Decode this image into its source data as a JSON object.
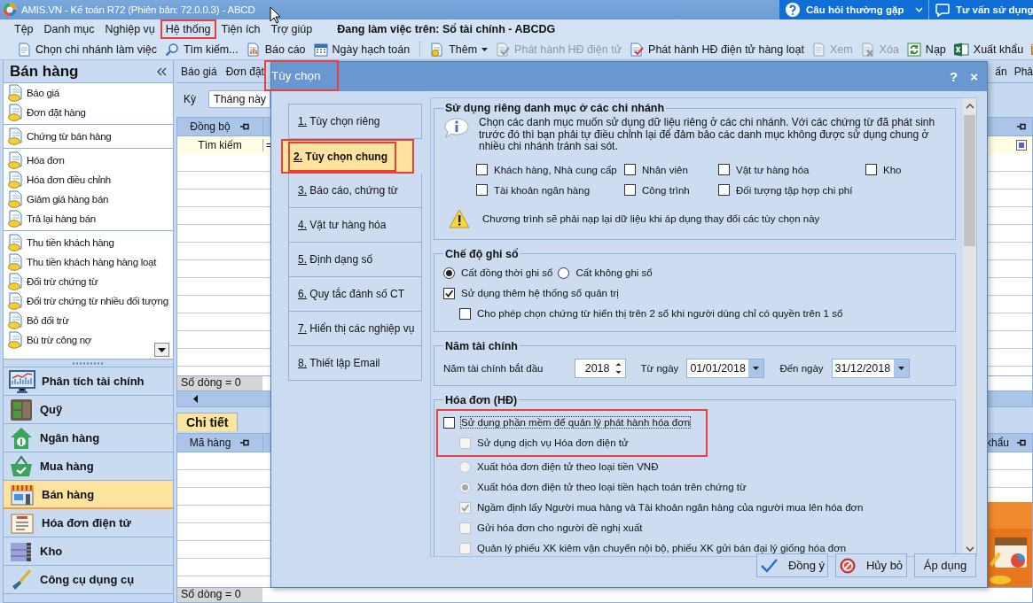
{
  "window": {
    "title": "AMIS.VN - Kế toán R72 (Phiên bản: 72.0.0.3) - ABCD"
  },
  "help_buttons": [
    {
      "label": "Câu hỏi thường gặp",
      "kind": "faq"
    },
    {
      "label": "Tư vấn sử dụng",
      "kind": "chat"
    }
  ],
  "menu": [
    {
      "label": "Tệp",
      "highlighted": false
    },
    {
      "label": "Danh mục",
      "highlighted": false
    },
    {
      "label": "Nghiệp vụ",
      "highlighted": false
    },
    {
      "label": "Hệ thống",
      "highlighted": true
    },
    {
      "label": "Tiện ích",
      "highlighted": false
    },
    {
      "label": "Trợ giúp",
      "highlighted": false
    }
  ],
  "working_on": "Đang làm việc trên: Sổ tài chính - ABCDG",
  "toolbar": [
    {
      "label": "Chọn chi nhánh làm việc",
      "kind": "branch",
      "disabled": false
    },
    {
      "label": "Tìm kiếm...",
      "kind": "search",
      "disabled": false
    },
    {
      "label": "Báo cáo",
      "kind": "report",
      "disabled": false
    },
    {
      "label": "Ngày hạch toán",
      "kind": "calendar",
      "disabled": false
    },
    {
      "kind": "separator"
    },
    {
      "label": "Thêm",
      "kind": "add",
      "disabled": false
    },
    {
      "label": "Phát hành HĐ điện tử",
      "kind": "publish",
      "disabled": true
    },
    {
      "label": "Phát hành HĐ điện tử hàng loạt",
      "kind": "publish",
      "disabled": false
    },
    {
      "label": "Xem",
      "kind": "view",
      "disabled": true
    },
    {
      "label": "Xóa",
      "kind": "delete",
      "disabled": true
    },
    {
      "label": "Nạp",
      "kind": "refresh",
      "disabled": false
    },
    {
      "label": "Xuất khẩu",
      "kind": "export",
      "disabled": false
    },
    {
      "kind": "mail",
      "disabled": false
    }
  ],
  "sidebar": {
    "title": "Bán hàng",
    "groups": [
      [
        "Báo giá",
        "Đơn đặt hàng"
      ],
      [
        "Chứng từ bán hàng"
      ],
      [
        "Hóa đơn",
        "Hóa đơn điều chỉnh",
        "Giảm giá hàng bán",
        "Trả lại hàng bán"
      ],
      [
        "Thu tiền khách hàng",
        "Thu tiền khách hàng hàng loạt",
        "Đối trừ chứng từ",
        "Đối trừ chứng từ nhiều đối tượng",
        "Bỏ đối trừ",
        "Bù trừ công nợ"
      ]
    ],
    "modules": [
      {
        "label": "Phân tích tài chính",
        "kind": "chart",
        "selected": false
      },
      {
        "label": "Quỹ",
        "kind": "safe",
        "selected": false
      },
      {
        "label": "Ngân hàng",
        "kind": "bank",
        "selected": false
      },
      {
        "label": "Mua hàng",
        "kind": "basket",
        "selected": false
      },
      {
        "label": "Bán hàng",
        "kind": "shop",
        "selected": true
      },
      {
        "label": "Hóa đơn điện tử",
        "kind": "invoice",
        "selected": false
      },
      {
        "label": "Kho",
        "kind": "warehouse",
        "selected": false
      },
      {
        "label": "Công cụ dụng cụ",
        "kind": "tool",
        "selected": false
      }
    ]
  },
  "workspace": {
    "tabs": [
      "Báo giá",
      "Đơn đặt"
    ],
    "right_tabs": [
      "ấn",
      "Phâ"
    ],
    "period": {
      "label": "Kỳ",
      "value": "Tháng này"
    },
    "master_grid": {
      "column": "Đồng bộ",
      "filter": [
        "Tìm kiếm",
        "="
      ],
      "footer": "Số dòng = 0"
    },
    "detail": {
      "tab": "Chi tiết",
      "column": "Mã hàng",
      "right_column": "khẩu",
      "footer": "Số dòng = 0"
    }
  },
  "dialog": {
    "title": "Tùy chọn",
    "title_highlighted": true,
    "help": "?",
    "close": "×",
    "nav": [
      {
        "label": "1. Tùy chọn riêng",
        "selected": false,
        "highlighted": false
      },
      {
        "label": "2. Tùy chọn chung",
        "selected": true,
        "highlighted": true
      },
      {
        "label": "3. Báo cáo, chứng từ",
        "selected": false,
        "highlighted": false
      },
      {
        "label": "4. Vật tư hàng hóa",
        "selected": false,
        "highlighted": false
      },
      {
        "label": "5. Định dạng số",
        "selected": false,
        "highlighted": false
      },
      {
        "label": "6. Quy tắc đánh số CT",
        "selected": false,
        "highlighted": false
      },
      {
        "label": "7. Hiển thị các nghiệp vụ",
        "selected": false,
        "highlighted": false
      },
      {
        "label": "8. Thiết lập Email",
        "selected": false,
        "highlighted": false
      }
    ],
    "sections": [
      {
        "kind": "branch_catalogs",
        "title": "Sử dụng riêng danh mục ở các chi nhánh",
        "info": "Chọn các danh mục muốn sử dụng dữ liệu riêng ở các chi nhánh. Với các chứng từ đã phát sinh trước đó thì bạn phải tự điều chỉnh lại để đảm bảo các danh mục không được sử dụng chung ở nhiều chi nhánh tránh sai sót.",
        "options": [
          {
            "label": "Khách hàng, Nhà cung cấp",
            "checked": false
          },
          {
            "label": "Nhân viên",
            "checked": false
          },
          {
            "label": "Vật tư hàng hóa",
            "checked": false
          },
          {
            "label": "Kho",
            "checked": false
          },
          {
            "label": "Tài khoản ngân hàng",
            "checked": false
          },
          {
            "label": "Công trình",
            "checked": false
          },
          {
            "label": "Đối tượng tập hợp chi phí",
            "checked": false
          }
        ],
        "warning": "Chương trình sẽ phải nạp lại dữ liệu khi áp dụng thay đổi các tùy chọn này"
      },
      {
        "kind": "posting_mode",
        "title": "Chế độ ghi sổ",
        "modes": [
          {
            "label": "Cất đồng thời ghi sổ",
            "selected": true
          },
          {
            "label": "Cất không ghi sổ",
            "selected": false
          }
        ],
        "options": [
          {
            "kind": "checkbox",
            "label": "Sử dụng thêm hệ thống sổ quản trị",
            "checked": true,
            "children": [
              {
                "kind": "checkbox",
                "label": "Cho phép chọn chứng từ hiển thị trên 2 sổ khi người dùng chỉ có quyền trên 1 sổ",
                "checked": false
              }
            ]
          }
        ]
      },
      {
        "kind": "fiscal_year",
        "title": "Năm tài chính",
        "start_label": "Năm tài chính bắt đầu",
        "start_year": "2018",
        "from_label": "Từ ngày",
        "from": "01/01/2018",
        "to_label": "Đến ngày",
        "to": "31/12/2018"
      },
      {
        "kind": "invoice",
        "title": "Hóa đơn (HĐ)",
        "options": [
          {
            "kind": "checkbox",
            "label": "Sử dụng phần mềm để quản lý phát hành hóa đơn",
            "checked": false,
            "disabled": false,
            "focused": true,
            "highlighted": true,
            "children": [
              {
                "kind": "checkbox",
                "label": "Sử dụng dịch vụ Hóa đơn điện tử",
                "checked": false,
                "disabled": true,
                "focused": false,
                "highlighted": true
              },
              {
                "kind": "radio",
                "label": "Xuất hóa đơn điện tử theo loại tiền VNĐ",
                "selected": false,
                "disabled": true,
                "focused": false,
                "highlighted": false
              },
              {
                "kind": "radio",
                "label": "Xuất hóa đơn điện tử theo loại tiền hạch toán trên chứng từ",
                "selected": true,
                "disabled": true,
                "focused": false,
                "highlighted": false
              },
              {
                "kind": "checkbox",
                "label": "Ngầm định lấy Người mua hàng và Tài khoản ngân hàng của người mua lên hóa đơn",
                "checked": true,
                "disabled": true,
                "focused": false,
                "highlighted": false
              },
              {
                "kind": "checkbox",
                "label": "Gửi hóa đơn cho người đề nghị xuất",
                "checked": false,
                "disabled": true,
                "focused": false,
                "highlighted": false
              },
              {
                "kind": "checkbox",
                "label": "Quản lý phiếu XK kiêm vận chuyển nội bộ, phiếu XK gửi bán đại lý giống hóa đơn",
                "checked": false,
                "disabled": true,
                "focused": false,
                "highlighted": false
              }
            ]
          }
        ]
      }
    ],
    "buttons": [
      {
        "label": "Đồng ý",
        "kind": "ok"
      },
      {
        "label": "Hủy bỏ",
        "kind": "cancel"
      },
      {
        "label": "Áp dụng",
        "kind": "apply"
      }
    ]
  }
}
